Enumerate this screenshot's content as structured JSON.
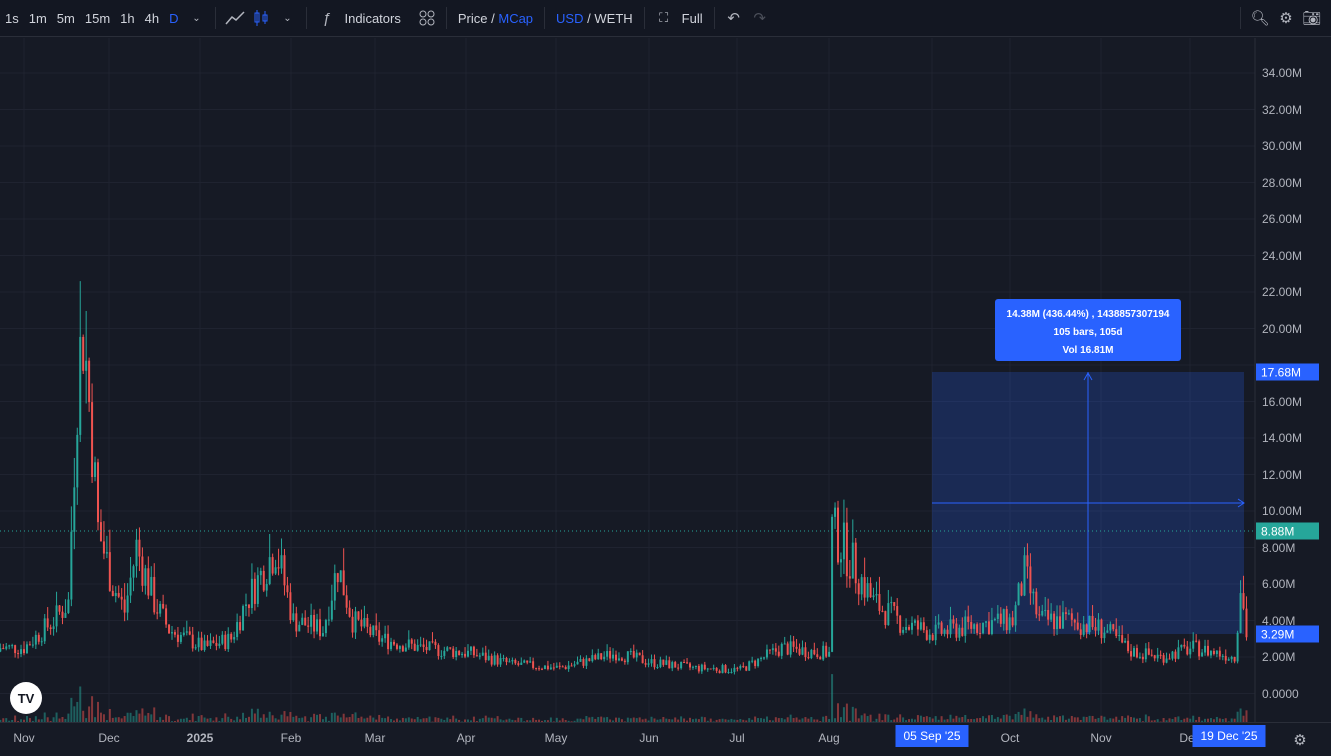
{
  "toolbar": {
    "timeframes": [
      "1s",
      "1m",
      "5m",
      "15m",
      "1h",
      "4h",
      "D"
    ],
    "active_timeframe": "D",
    "indicators": "Indicators",
    "price": "Price",
    "slash": "/",
    "mcap": "MCap",
    "usd": "USD",
    "weth": "WETH",
    "full": "Full"
  },
  "axis": {
    "y_labels": [
      "34.00M",
      "32.00M",
      "30.00M",
      "28.00M",
      "26.00M",
      "24.00M",
      "22.00M",
      "20.00M",
      "16.00M",
      "14.00M",
      "12.00M",
      "10.00M",
      "8.00M",
      "6.00M",
      "4.00M",
      "2.00M",
      "0.0000"
    ],
    "x_labels": [
      "Nov",
      "Dec",
      "2025",
      "Feb",
      "Mar",
      "Apr",
      "May",
      "Jun",
      "Jul",
      "Aug",
      "Oct",
      "Nov",
      "Dec"
    ],
    "current_price_tag": "8.88M",
    "measure_top_tag": "17.68M",
    "measure_bottom_tag": "3.29M",
    "measure_start_date": "05 Sep '25",
    "measure_end_date": "19 Dec '25"
  },
  "measure": {
    "line1": "14.38M (436.44%) , 1438857307194",
    "line2": "105 bars, 105d",
    "line3": "Vol 16.81M"
  },
  "logo": "TV",
  "colors": {
    "up": "#26a69a",
    "down": "#ef5350",
    "accent": "#2962ff",
    "bg": "#161a25"
  },
  "chart_data": {
    "type": "candlestick",
    "unit": "USD market cap (M)",
    "start": "2024-11-01",
    "ylim": [
      -1,
      36
    ],
    "keypoints": [
      [
        0,
        2.5
      ],
      [
        10,
        4
      ],
      [
        15,
        5
      ],
      [
        18,
        17
      ],
      [
        20,
        20
      ],
      [
        23,
        14
      ],
      [
        25,
        9
      ],
      [
        30,
        6
      ],
      [
        34,
        4.5
      ],
      [
        38,
        8
      ],
      [
        44,
        5
      ],
      [
        49,
        3.5
      ],
      [
        61,
        2.5
      ],
      [
        70,
        3
      ],
      [
        75,
        5
      ],
      [
        85,
        8
      ],
      [
        91,
        4
      ],
      [
        101,
        3.5
      ],
      [
        106,
        7
      ],
      [
        111,
        4
      ],
      [
        120,
        3
      ],
      [
        134,
        2.5
      ],
      [
        151,
        2.2
      ],
      [
        165,
        1.6
      ],
      [
        181,
        1.4
      ],
      [
        200,
        2.2
      ],
      [
        212,
        1.7
      ],
      [
        226,
        1.4
      ],
      [
        242,
        1.3
      ],
      [
        256,
        2.5
      ],
      [
        272,
        2.2
      ],
      [
        273,
        9
      ],
      [
        277,
        8
      ],
      [
        287,
        5
      ],
      [
        297,
        3.8
      ],
      [
        308,
        3.3
      ],
      [
        323,
        3.8
      ],
      [
        334,
        4
      ],
      [
        338,
        6.5
      ],
      [
        343,
        4
      ],
      [
        353,
        4
      ],
      [
        365,
        3.5
      ],
      [
        374,
        2.3
      ],
      [
        384,
        2
      ],
      [
        395,
        2.5
      ],
      [
        409,
        2
      ],
      [
        411,
        6
      ],
      [
        413,
        3.29
      ]
    ],
    "last_close": "8.88M"
  }
}
